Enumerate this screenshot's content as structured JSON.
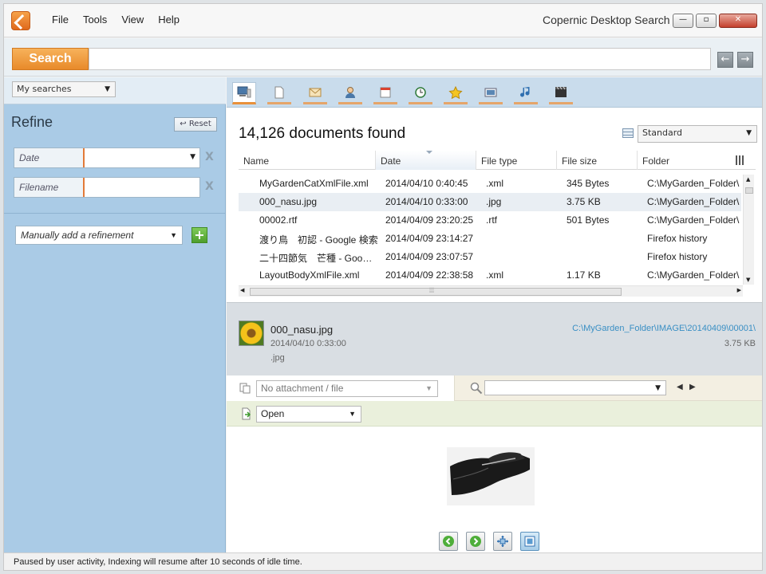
{
  "menu": {
    "items": [
      "File",
      "Tools",
      "View",
      "Help"
    ]
  },
  "app": {
    "title": "Copernic Desktop Search"
  },
  "window_controls": {
    "minimize": "—",
    "restore": "▫",
    "close": "✕"
  },
  "search": {
    "button_label": "Search",
    "query": "",
    "back": "←",
    "forward": "→"
  },
  "left": {
    "my_searches": "My searches",
    "refine_title": "Refine",
    "reset_label": "Reset",
    "fields": [
      {
        "label": "Date"
      },
      {
        "label": "Filename"
      }
    ],
    "clear_glyph": "X",
    "manual_refinement": "Manually add a refinement",
    "add_glyph": "+"
  },
  "tabs": [
    "all-icon",
    "documents-icon",
    "emails-icon",
    "contacts-icon",
    "calendar-icon",
    "history-icon",
    "favorites-icon",
    "pictures-icon",
    "music-icon",
    "videos-icon"
  ],
  "results": {
    "count_text": "14,126 documents found",
    "view_mode": "Standard",
    "columns": [
      "Name",
      "Date",
      "File type",
      "File size",
      "Folder"
    ],
    "rows": [
      {
        "icon": "xml-file-icon",
        "name": "MyGardenCatXmlFile.xml",
        "date": "2014/04/10 0:40:45",
        "type": ".xml",
        "size": "345 Bytes",
        "folder": "C:\\MyGarden_Folder\\"
      },
      {
        "icon": "image-file-icon",
        "name": "000_nasu.jpg",
        "date": "2014/04/10 0:33:00",
        "type": ".jpg",
        "size": "3.75 KB",
        "folder": "C:\\MyGarden_Folder\\"
      },
      {
        "icon": "rtf-file-icon",
        "name": "00002.rtf",
        "date": "2014/04/09 23:20:25",
        "type": ".rtf",
        "size": "501 Bytes",
        "folder": "C:\\MyGarden_Folder\\"
      },
      {
        "icon": "history-clock-icon",
        "name": "渡り鳥　初認 - Google 検索",
        "date": "2014/04/09 23:14:27",
        "type": "",
        "size": "",
        "folder": "Firefox history"
      },
      {
        "icon": "history-clock-icon",
        "name": "二十四節気　芒種 - Goo…",
        "date": "2014/04/09 23:07:57",
        "type": "",
        "size": "",
        "folder": "Firefox history"
      },
      {
        "icon": "xml-file-icon",
        "name": "LayoutBodyXmlFile.xml",
        "date": "2014/04/09 22:38:58",
        "type": ".xml",
        "size": "1.17 KB",
        "folder": "C:\\MyGarden_Folder\\"
      }
    ],
    "hscroll_grip": "⦙⦙⦙"
  },
  "preview": {
    "name": "000_nasu.jpg",
    "date": "2014/04/10 0:33:00",
    "type": ".jpg",
    "path": "C:\\MyGarden_Folder\\IMAGE\\20140409\\00001\\",
    "size": "3.75 KB",
    "attachment_placeholder": "No attachment / file",
    "find_value": "",
    "open_label": "Open"
  },
  "status": {
    "text": "Paused by user activity, Indexing will resume after 10 seconds of idle time."
  },
  "colors": {
    "accent_orange": "#e88a2a",
    "sidebar_blue": "#aacbe6",
    "link_blue": "#3a8fc4"
  }
}
